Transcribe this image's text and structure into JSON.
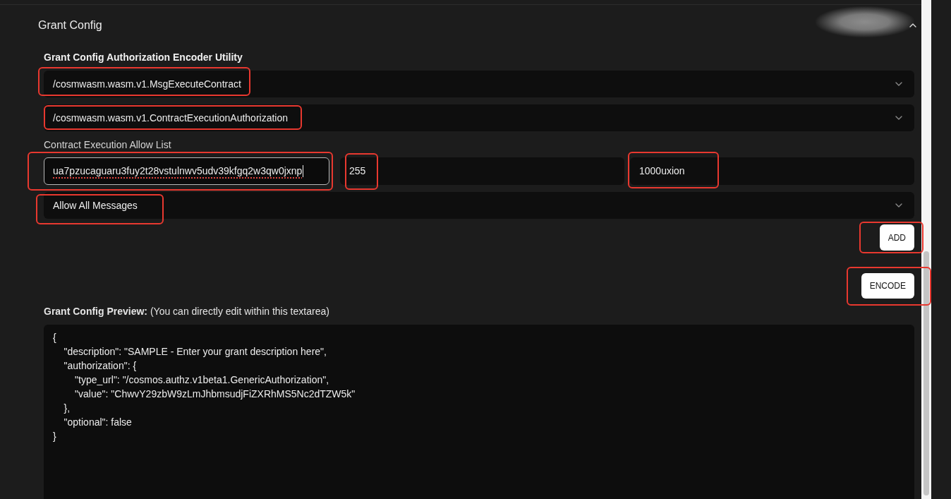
{
  "section": {
    "title": "Grant Config",
    "expanded": true
  },
  "encoder": {
    "title": "Grant Config Authorization Encoder Utility",
    "message_type": {
      "value": "/cosmwasm.wasm.v1.MsgExecuteContract",
      "highlighted": true
    },
    "authorization_type": {
      "value": "/cosmwasm.wasm.v1.ContractExecutionAuthorization",
      "highlighted": true
    },
    "allow_list": {
      "label": "Contract Execution Allow List",
      "fields": [
        {
          "value": "ua7pzucaguaru3fuy2t28vstulnwv5udv39kfgq2w3qw0jxnp",
          "focused": true,
          "misspelled": true,
          "highlighted": true
        },
        {
          "value": "255",
          "focused": false,
          "misspelled": false,
          "highlighted": true
        },
        {
          "value": "1000uxion",
          "focused": false,
          "misspelled": false,
          "highlighted": true
        }
      ]
    },
    "filter": {
      "value": "Allow All Messages",
      "highlighted": true
    },
    "buttons": [
      {
        "label": "ADD",
        "highlighted": true
      },
      {
        "label": "ENCODE",
        "highlighted": true
      }
    ]
  },
  "preview": {
    "label": "**Grant Config Preview:** (You can directly edit within this textarea)",
    "value": "{\n    \"description\": \"SAMPLE - Enter your grant description here\",\n    \"authorization\": {\n        \"type_url\": \"/cosmos.authz.v1beta1.GenericAuthorization\",\n        \"value\": \"ChwvY29zbW9zLmJhbmsudjFiZXRhMS5Nc2dTZW5k\"\n    },\n    \"optional\": false\n}"
  }
}
